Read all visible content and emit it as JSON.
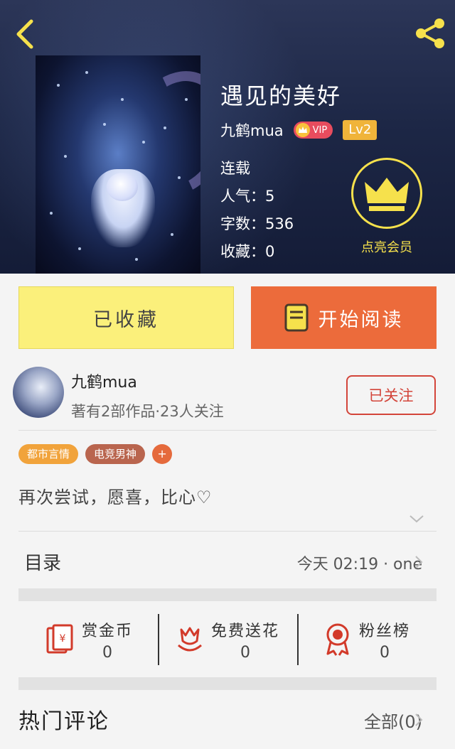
{
  "header": {
    "back_icon": "chevron-left-icon",
    "share_icon": "share-icon",
    "accent_color": "#f6e14c"
  },
  "book": {
    "title": "遇见的美好",
    "author": "九鹤mua",
    "vip_label": "VIP",
    "level": "Lv2",
    "status": "连载",
    "popularity": "人气：5",
    "word_count": "字数：536",
    "favorites": "收藏：0"
  },
  "member": {
    "label": "点亮会员",
    "icon": "crown-icon"
  },
  "actions": {
    "collected_label": "已收藏",
    "read_label": "开始阅读",
    "collected_color": "#fbf07b",
    "read_color": "#ec6b3b"
  },
  "author_card": {
    "name": "九鹤mua",
    "meta": "著有2部作品·23人关注",
    "follow_label": "已关注"
  },
  "tags": [
    "都市言情",
    "电竞男神"
  ],
  "tag_add": "+",
  "description": "再次尝试，愿喜，比心♡",
  "toc": {
    "title": "目录",
    "latest": "今天 02:19 · one"
  },
  "rewards": [
    {
      "label": "赏金币",
      "value": "0",
      "icon": "red-envelope-icon"
    },
    {
      "label": "免费送花",
      "value": "0",
      "icon": "flower-icon"
    },
    {
      "label": "粉丝榜",
      "value": "0",
      "icon": "medal-icon"
    }
  ],
  "comments": {
    "title": "热门评论",
    "all_label": "全部(0)"
  }
}
